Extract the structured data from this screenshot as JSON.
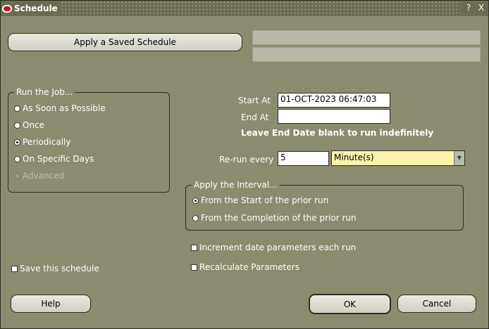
{
  "window": {
    "title": "Schedule",
    "buttons": [
      "?",
      "X"
    ]
  },
  "apply_saved_schedule_label": "Apply a Saved Schedule",
  "run_job": {
    "title": "Run the Job...",
    "options": [
      {
        "label": "As Soon as Possible",
        "selected": false,
        "enabled": true
      },
      {
        "label": "Once",
        "selected": false,
        "enabled": true
      },
      {
        "label": "Periodically",
        "selected": true,
        "enabled": true
      },
      {
        "label": "On Specific Days",
        "selected": false,
        "enabled": true
      },
      {
        "label": "Advanced",
        "selected": false,
        "enabled": false
      }
    ]
  },
  "start_at": {
    "label": "Start At",
    "value": "01-OCT-2023 06:47:03"
  },
  "end_at": {
    "label": "End At",
    "value": ""
  },
  "end_date_hint": "Leave End Date blank to run indefinitely",
  "rerun": {
    "label": "Re-run every",
    "value": "5",
    "unit": "Minute(s)"
  },
  "apply_interval": {
    "title": "Apply the Interval...",
    "options": [
      {
        "label": "From the Start of the prior run",
        "selected": true
      },
      {
        "label": "From the Completion of the prior run",
        "selected": false
      }
    ]
  },
  "checkboxes": {
    "increment": "Increment date parameters each run",
    "recalculate": "Recalculate Parameters",
    "save_schedule": "Save this schedule"
  },
  "buttons": {
    "help": "Help",
    "ok": "OK",
    "cancel": "Cancel"
  }
}
